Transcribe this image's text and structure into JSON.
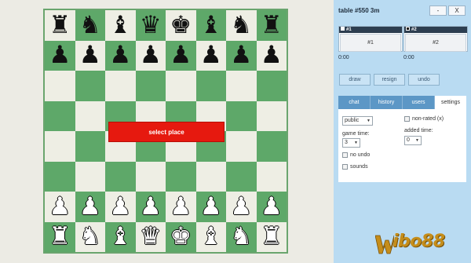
{
  "board": {
    "rows": [
      [
        {
          "p": "♜",
          "c": "black"
        },
        {
          "p": "♞",
          "c": "black"
        },
        {
          "p": "♝",
          "c": "black"
        },
        {
          "p": "♛",
          "c": "black"
        },
        {
          "p": "♚",
          "c": "black"
        },
        {
          "p": "♝",
          "c": "black"
        },
        {
          "p": "♞",
          "c": "black"
        },
        {
          "p": "♜",
          "c": "black"
        }
      ],
      [
        {
          "p": "♟",
          "c": "black"
        },
        {
          "p": "♟",
          "c": "black"
        },
        {
          "p": "♟",
          "c": "black"
        },
        {
          "p": "♟",
          "c": "black"
        },
        {
          "p": "♟",
          "c": "black"
        },
        {
          "p": "♟",
          "c": "black"
        },
        {
          "p": "♟",
          "c": "black"
        },
        {
          "p": "♟",
          "c": "black"
        }
      ],
      [
        null,
        null,
        null,
        null,
        null,
        null,
        null,
        null
      ],
      [
        null,
        null,
        null,
        null,
        null,
        null,
        null,
        null
      ],
      [
        null,
        null,
        null,
        null,
        null,
        null,
        null,
        null
      ],
      [
        null,
        null,
        null,
        null,
        null,
        null,
        null,
        null
      ],
      [
        {
          "p": "♟",
          "c": "white"
        },
        {
          "p": "♟",
          "c": "white"
        },
        {
          "p": "♟",
          "c": "white"
        },
        {
          "p": "♟",
          "c": "white"
        },
        {
          "p": "♟",
          "c": "white"
        },
        {
          "p": "♟",
          "c": "white"
        },
        {
          "p": "♟",
          "c": "white"
        },
        {
          "p": "♟",
          "c": "white"
        }
      ],
      [
        {
          "p": "♜",
          "c": "white"
        },
        {
          "p": "♞",
          "c": "white"
        },
        {
          "p": "♝",
          "c": "white"
        },
        {
          "p": "♛",
          "c": "white"
        },
        {
          "p": "♚",
          "c": "white"
        },
        {
          "p": "♝",
          "c": "white"
        },
        {
          "p": "♞",
          "c": "white"
        },
        {
          "p": "♜",
          "c": "white"
        }
      ]
    ],
    "light_color": "#eeeee4",
    "dark_color": "#5ea869"
  },
  "overlay": {
    "select_place_label": "select place"
  },
  "panel": {
    "title": "table #550   3m",
    "minimize_label": "-",
    "close_label": "X",
    "player1": {
      "header": "#1",
      "button": "#1",
      "timer": "0:00",
      "swatch": "#ffffff"
    },
    "player2": {
      "header": "#2",
      "button": "#2",
      "timer": "0:00",
      "swatch": "#1a1a1a"
    },
    "actions": {
      "draw": "draw",
      "resign": "resign",
      "undo": "undo"
    },
    "tabs": [
      "chat",
      "history",
      "users",
      "settings"
    ],
    "active_tab": "settings",
    "settings": {
      "visibility_value": "public",
      "non_rated_label": "non-rated (x)",
      "game_time_label": "game time:",
      "game_time_value": "3",
      "added_time_label": "added time:",
      "added_time_value": "0",
      "no_undo_label": "no undo",
      "sounds_label": "sounds"
    }
  },
  "watermark": {
    "text": "ibo88"
  }
}
